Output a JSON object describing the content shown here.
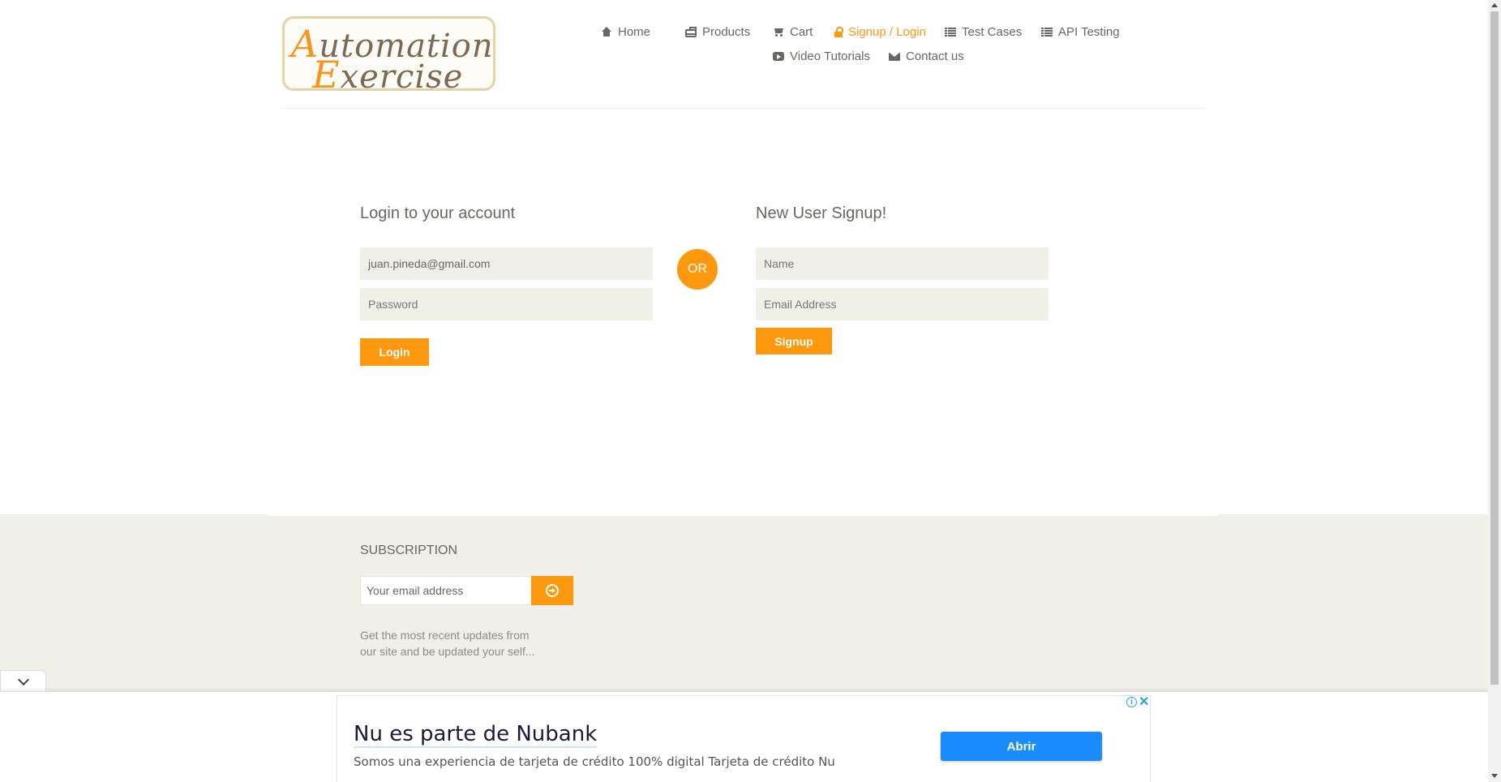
{
  "logo": {
    "line1_cap": "A",
    "line1_rest": "utomation",
    "line2_cap": "E",
    "line2_rest": "xercise"
  },
  "nav": {
    "home": "Home",
    "products": "Products",
    "cart": "Cart",
    "signup_login": "Signup / Login",
    "test_cases": "Test Cases",
    "api_testing": "API Testing",
    "video_tutorials": "Video Tutorials",
    "contact_us": "Contact us"
  },
  "login": {
    "title": "Login to your account",
    "email_value": "juan.pineda@gmail.com",
    "password_placeholder": "Password",
    "button": "Login"
  },
  "or_label": "OR",
  "signup": {
    "title": "New User Signup!",
    "name_placeholder": "Name",
    "email_placeholder": "Email Address",
    "button": "Signup"
  },
  "footer": {
    "subscription_title": "SUBSCRIPTION",
    "email_placeholder": "Your email address",
    "description": "Get the most recent updates from our site and be updated your self..."
  },
  "ad": {
    "title": "Nu es parte de Nubank",
    "description": "Somos una experiencia de tarjeta de crédito 100% digital Tarjeta de crédito Nu",
    "cta": "Abrir",
    "info_symbol": "i",
    "close_symbol": "✕"
  },
  "colors": {
    "accent": "#fe980f",
    "field_bg": "#f0f0e9",
    "text": "#696763",
    "ad_button": "#1a8cff"
  },
  "icons": [
    "home-icon",
    "products-icon",
    "cart-icon",
    "lock-icon",
    "list-icon",
    "video-icon",
    "envelope-icon",
    "arrow-circle-right-icon",
    "chevron-down-icon",
    "info-icon",
    "close-icon"
  ]
}
